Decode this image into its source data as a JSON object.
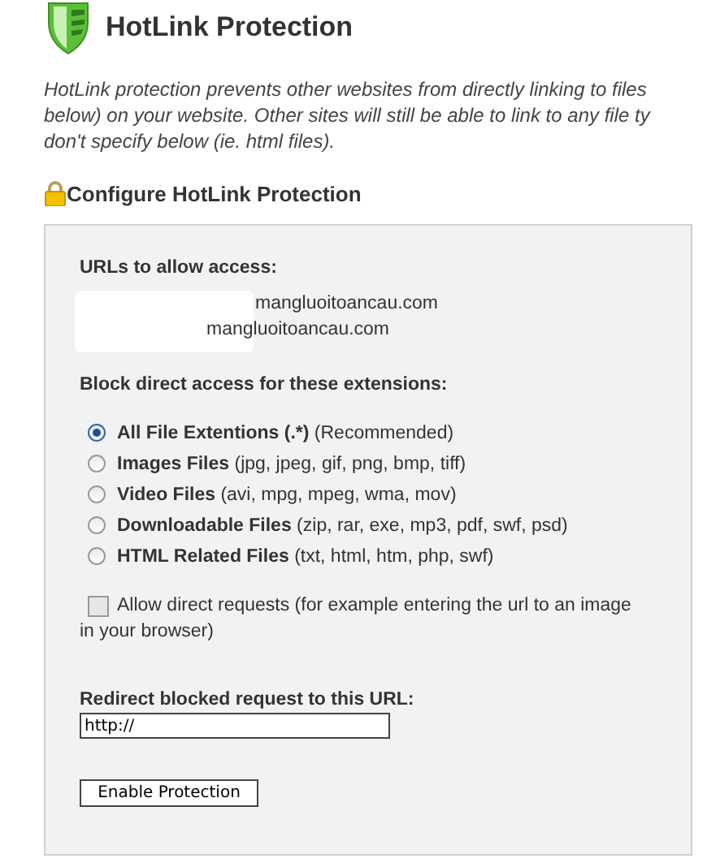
{
  "header": {
    "title": "HotLink Protection"
  },
  "description_lines": [
    "HotLink protection prevents other websites from directly linking to files",
    "below) on your website. Other sites will still be able to link to any file ty",
    "don't specify below (ie. html files)."
  ],
  "section_title": "Configure HotLink Protection",
  "form": {
    "urls_label": "URLs to allow access:",
    "urls": [
      "mangluoitoancau.com",
      "mangluoitoancau.com"
    ],
    "extensions_label": "Block direct access for these extensions:",
    "extension_options": [
      {
        "name": "All File Extentions (.*)",
        "detail": "(Recommended)",
        "selected": true
      },
      {
        "name": "Images Files",
        "detail": "(jpg, jpeg, gif, png, bmp, tiff)",
        "selected": false
      },
      {
        "name": "Video Files",
        "detail": "(avi, mpg, mpeg, wma, mov)",
        "selected": false
      },
      {
        "name": "Downloadable Files",
        "detail": "(zip, rar, exe, mp3, pdf, swf, psd)",
        "selected": false
      },
      {
        "name": "HTML Related Files",
        "detail": "(txt, html, htm, php, swf)",
        "selected": false
      }
    ],
    "allow_direct": {
      "label_lines": [
        "Allow direct requests (for example entering the url to an image",
        "in your browser)"
      ],
      "checked": false
    },
    "redirect_label": "Redirect blocked request to this URL:",
    "redirect_url": "http://",
    "submit": "Enable Protection"
  }
}
